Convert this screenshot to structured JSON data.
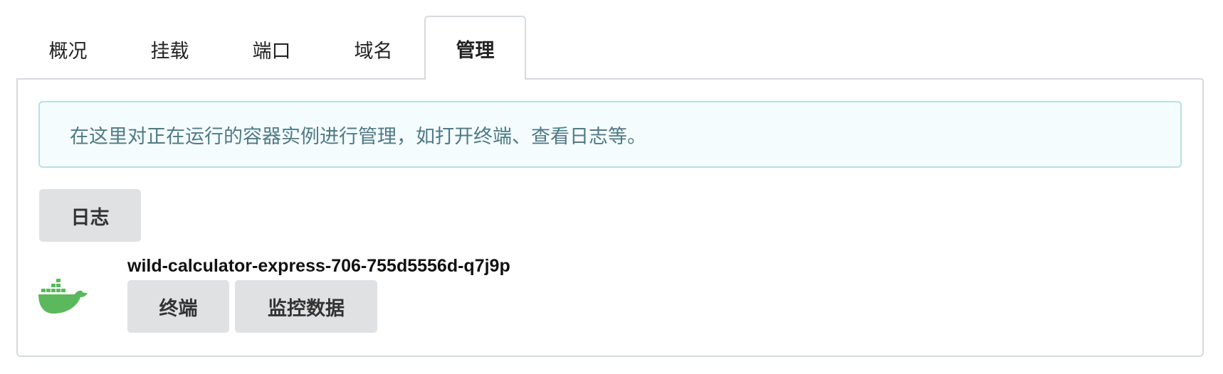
{
  "tabs": [
    {
      "label": "概况",
      "active": false
    },
    {
      "label": "挂载",
      "active": false
    },
    {
      "label": "端口",
      "active": false
    },
    {
      "label": "域名",
      "active": false
    },
    {
      "label": "管理",
      "active": true
    }
  ],
  "panel": {
    "info_text": "在这里对正在运行的容器实例进行管理，如打开终端、查看日志等。",
    "logs_button": "日志",
    "container": {
      "name": "wild-calculator-express-706-755d5556d-q7j9p",
      "icon": "docker-icon",
      "terminal_button": "终端",
      "metrics_button": "监控数据"
    }
  },
  "colors": {
    "docker_green": "#5cb85c",
    "info_border": "#b9dfe4",
    "info_background": "#f5fcfd",
    "info_text": "#4e7a86",
    "button_background": "#e0e1e3"
  }
}
